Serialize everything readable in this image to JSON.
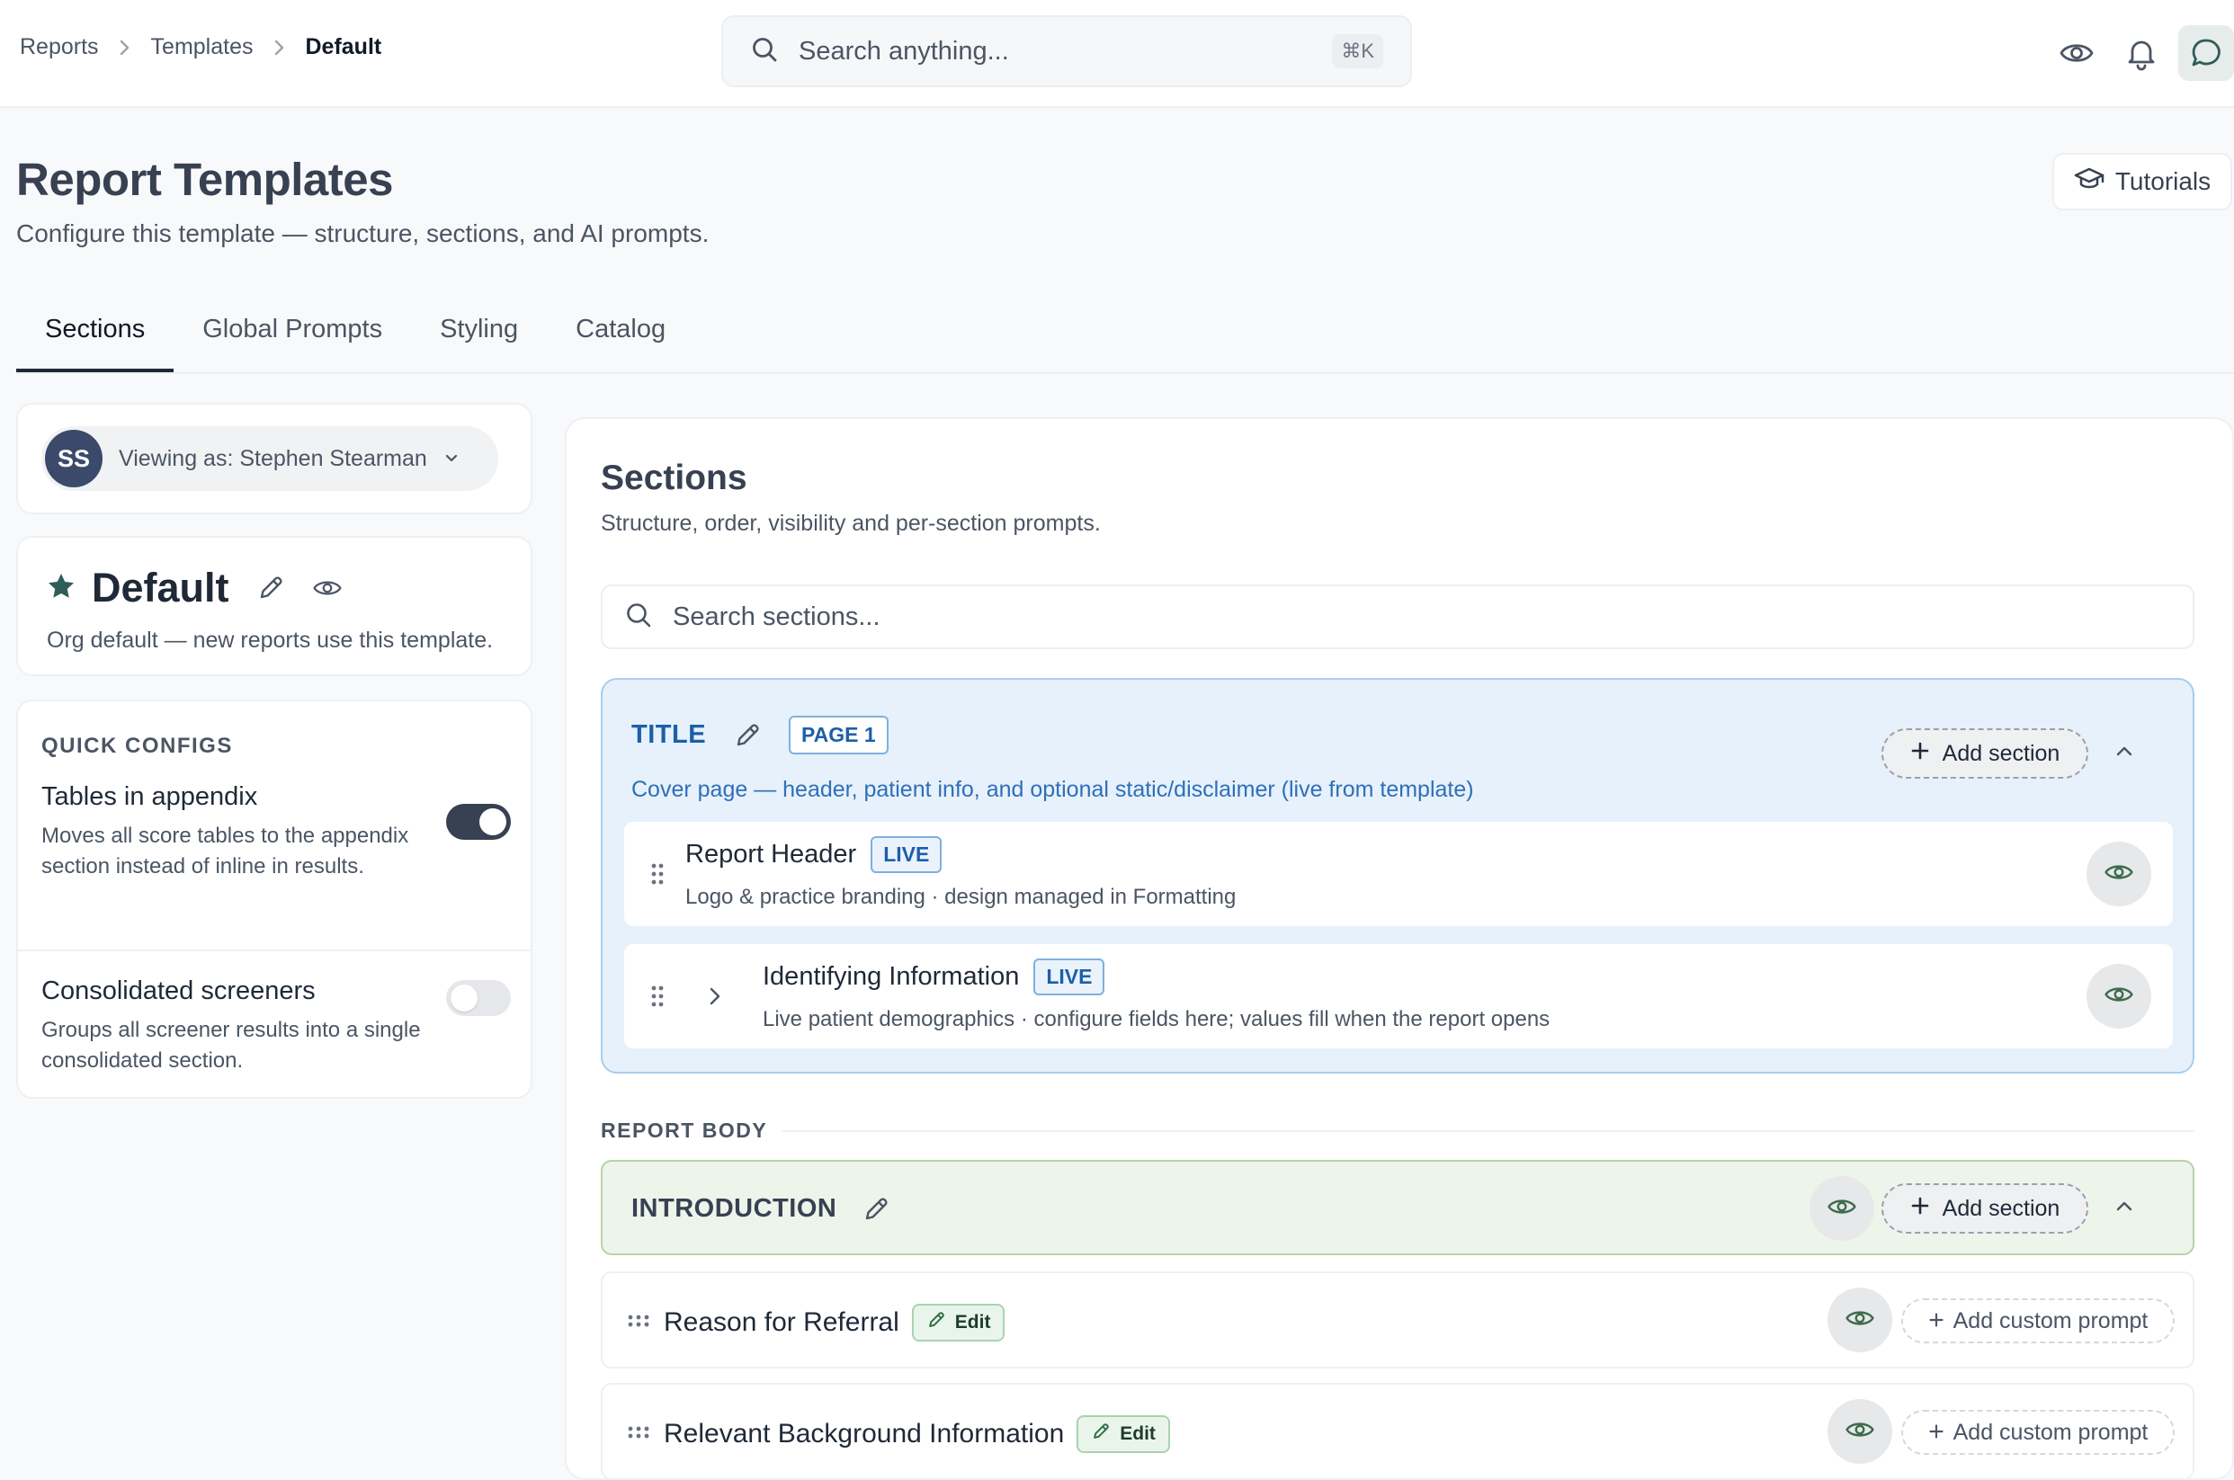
{
  "breadcrumb": [
    "Reports",
    "Templates",
    "Default"
  ],
  "search": {
    "placeholder": "Search anything...",
    "shortcut": "⌘K"
  },
  "header": {
    "title": "Report Templates",
    "subtitle": "Configure this template — structure, sections, and AI prompts.",
    "tutorials_label": "Tutorials"
  },
  "tabs": [
    {
      "label": "Sections",
      "active": true
    },
    {
      "label": "Global Prompts",
      "active": false
    },
    {
      "label": "Styling",
      "active": false
    },
    {
      "label": "Catalog",
      "active": false
    }
  ],
  "viewer": {
    "initials": "SS",
    "label": "Viewing as: Stephen Stearman"
  },
  "template": {
    "name": "Default",
    "description": "Org default — new reports use this template."
  },
  "quick_configs": {
    "heading": "QUICK CONFIGS",
    "items": [
      {
        "title": "Tables in appendix",
        "description": "Moves all score tables to the appendix section instead of inline in results.",
        "enabled": true
      },
      {
        "title": "Consolidated screeners",
        "description": "Groups all screener results into a single consolidated section.",
        "enabled": false
      }
    ]
  },
  "sections_panel": {
    "title": "Sections",
    "subtitle": "Structure, order, visibility and per-section prompts.",
    "search_placeholder": "Search sections...",
    "title_group": {
      "name": "TITLE",
      "badge": "PAGE 1",
      "description": "Cover page — header, patient info, and optional static/disclaimer (live from template)",
      "add_label": "Add section",
      "rows": [
        {
          "title": "Report Header",
          "badge": "LIVE",
          "description": "Logo & practice branding · design managed in Formatting"
        },
        {
          "title": "Identifying Information",
          "badge": "LIVE",
          "description": "Live patient demographics · configure fields here; values fill when the report opens"
        }
      ]
    },
    "body_label": "REPORT BODY",
    "intro_group": {
      "name": "INTRODUCTION",
      "add_label": "Add section"
    },
    "prompt_rows": [
      {
        "title": "Reason for Referral",
        "edit_label": "Edit",
        "action_label": "Add custom prompt"
      },
      {
        "title": "Relevant Background Information",
        "edit_label": "Edit",
        "action_label": "Add custom prompt"
      }
    ]
  },
  "colors": {
    "accent_dark": "#374151",
    "title_group_bg": "#e6f1fb",
    "title_group_text": "#1d5fa8",
    "intro_group_bg": "#edf4ea",
    "star": "#2f5d58",
    "eye_green": "#3d6b4d"
  },
  "icons": [
    "search-icon",
    "eye-icon",
    "bell-icon",
    "chat-icon",
    "graduation-cap-icon",
    "chevron-down-icon",
    "star-icon",
    "pencil-icon",
    "plus-icon",
    "chevron-up-icon",
    "chevron-right-icon",
    "drag-handle-icon"
  ]
}
